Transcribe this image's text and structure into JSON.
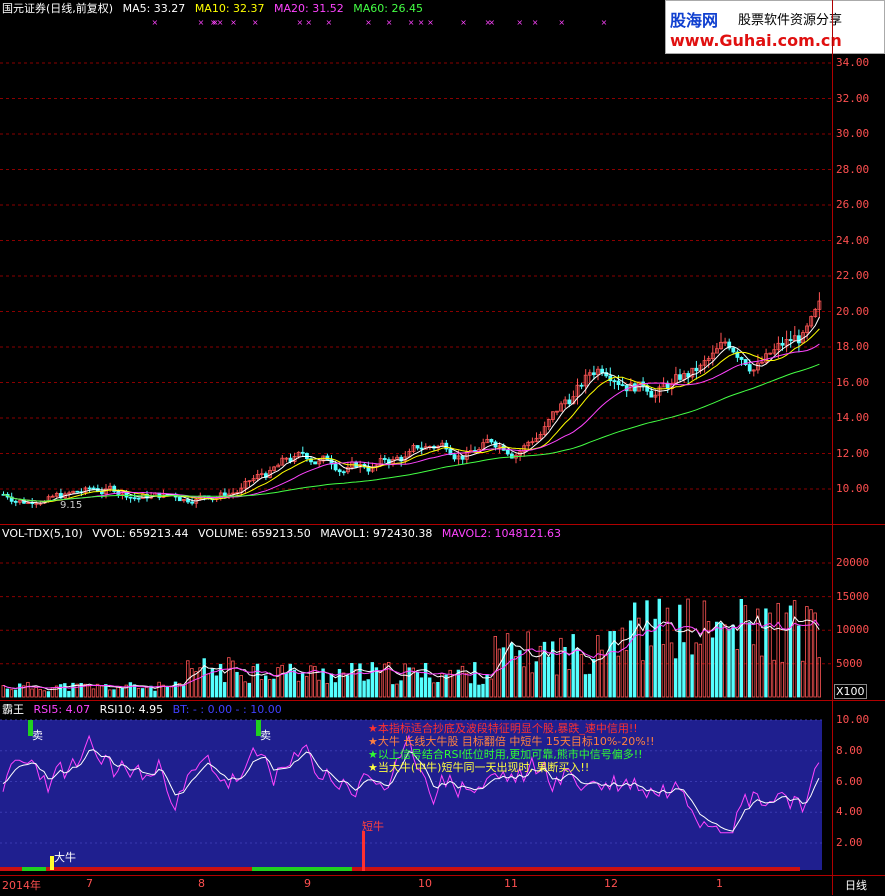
{
  "price_header": {
    "title": "国元证券(日线,前复权)",
    "ma5": "MA5: 33.27",
    "ma10": "MA10: 32.37",
    "ma20": "MA20: 31.52",
    "ma60": "MA60: 26.45",
    "colors": {
      "ma5": "#ffffff",
      "ma10": "#ffff00",
      "ma20": "#ff44ff",
      "ma60": "#44ff44"
    }
  },
  "price_axis": [
    "34.00",
    "32.00",
    "30.00",
    "28.00",
    "26.00",
    "24.00",
    "22.00",
    "20.00",
    "18.00",
    "16.00",
    "14.00",
    "12.00",
    "10.00"
  ],
  "price_low_label": "9.15",
  "vol_header": {
    "name": "VOL-TDX(5,10)",
    "vvol": "VVOL: 659213.44",
    "volume": "VOLUME: 659213.50",
    "mavol1": "MAVOL1: 972430.38",
    "mavol2": "MAVOL2: 1048121.63"
  },
  "vol_axis": [
    "20000",
    "15000",
    "10000",
    "5000"
  ],
  "vol_unit": "X100",
  "ind_header": {
    "name": "霸王",
    "rsi5": "RSI5: 4.07",
    "rsi10": "RSI10: 4.95",
    "bt": "BT: - : 0.00 - : 10.00"
  },
  "ind_axis": [
    "10.00",
    "8.00",
    "6.00",
    "4.00",
    "2.00"
  ],
  "notes": [
    {
      "text": "★本指标适合抄底及波段特征明显个股,暴跌_速中信用!!",
      "color": "#ff3030"
    },
    {
      "text": "★大牛 长线大牛股 目标翻倍  中短牛 15天目标10%-20%!!",
      "color": "#ff8040"
    },
    {
      "text": "★以上信号结合RSI低位时用,更加可靠,熊市中信号偏多!!",
      "color": "#30ff30"
    },
    {
      "text": "★当大牛(中牛)短牛同一天出现时, 果断买入!!",
      "color": "#ffff40"
    }
  ],
  "signals": {
    "sell": "卖",
    "sell2": "卖",
    "bull": "大牛",
    "short_bull": "短牛"
  },
  "x_axis": {
    "year": "2014年",
    "months": [
      "7",
      "8",
      "9",
      "10",
      "11",
      "12",
      "1"
    ],
    "period": "日线"
  },
  "logo": {
    "brand": "股海网",
    "slogan": "股票软件资源分享",
    "url": "www.Guhai.com.cn"
  }
}
